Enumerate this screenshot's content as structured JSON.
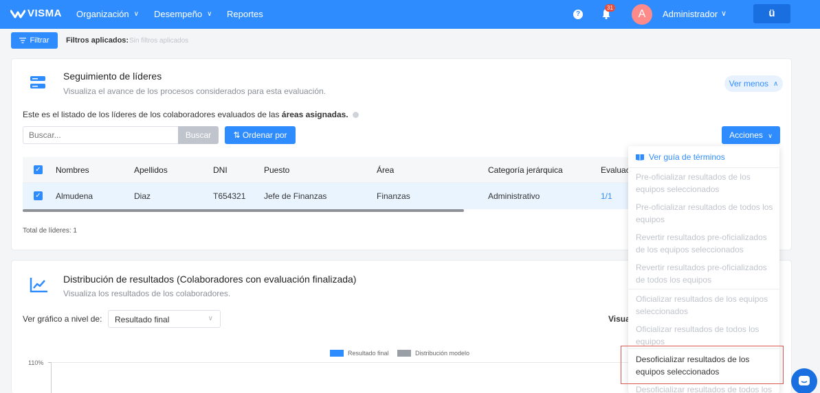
{
  "header": {
    "logo_text": "VISMA",
    "nav": [
      {
        "label": "Organización",
        "has_chevron": true
      },
      {
        "label": "Desempeño",
        "has_chevron": true
      },
      {
        "label": "Reportes",
        "has_chevron": false
      }
    ],
    "help_icon": "question-icon",
    "notifications_count": "31",
    "avatar_initial": "A",
    "user_name": "Administrador",
    "app_button_icon": "app-logo-icon",
    "colors": {
      "bar": "#2f8cff",
      "avatar": "#ff8a8a",
      "badge": "#e74c3c"
    }
  },
  "filters": {
    "button_label": "Filtrar",
    "applied_label": "Filtros aplicados:",
    "applied_value": "Sin filtros aplicados"
  },
  "leaders": {
    "title": "Seguimiento de líderes",
    "subtitle": "Visualiza el avance de los procesos considerados para esta evaluación.",
    "toggle_label": "Ver menos",
    "info_prefix": "Este es el listado de los líderes de los colaboradores evaluados de las",
    "info_bold": "áreas asignadas.",
    "search_placeholder": "Buscar...",
    "search_button": "Buscar",
    "sort_button": "Ordenar por",
    "actions_button": "Acciones",
    "columns": [
      "Nombres",
      "Apellidos",
      "DNI",
      "Puesto",
      "Área",
      "Categoría jerárquica",
      "Evaluaci"
    ],
    "rows": [
      {
        "nombres": "Almudena",
        "apellidos": "Diaz",
        "dni": "T654321",
        "puesto": "Jefe de Finanzas",
        "area": "Finanzas",
        "categoria": "Administrativo",
        "evaluacion": "1/1",
        "selected": true
      }
    ],
    "total_label": "Total de líderes: 1"
  },
  "distribution": {
    "title": "Distribución de resultados",
    "title_suffix": "(Colaboradores con evaluación finalizada)",
    "subtitle": "Visualiza los resultados de los colaboradores.",
    "level_label": "Ver gráfico a nivel de:",
    "level_value": "Resultado final",
    "right_label": "Visua",
    "legend": [
      {
        "name": "Resultado final",
        "color": "#2f8cff"
      },
      {
        "name": "Distribución modelo",
        "color": "#9a9ea5"
      }
    ],
    "y_tick_top": "110%"
  },
  "actions_menu": {
    "guide": "Ver guía de términos",
    "items": [
      {
        "label": "Pre-oficializar resultados de los equipos seleccionados",
        "enabled": false
      },
      {
        "label": "Pre-oficializar resultados de todos los equipos",
        "enabled": false
      },
      {
        "label": "Revertir resultados pre-oficializados de los equipos seleccionados",
        "enabled": false
      },
      {
        "label": "Revertir resultados pre-oficializados de todos los equipos",
        "enabled": false
      },
      {
        "label": "Oficializar resultados de los equipos seleccionados",
        "enabled": false
      },
      {
        "label": "Oficializar resultados de todos los equipos",
        "enabled": false
      },
      {
        "label": "Desoficializar resultados de los equipos seleccionados",
        "enabled": true,
        "highlighted": true
      },
      {
        "label": "Desoficializar resultados de todos los",
        "enabled": false
      }
    ]
  }
}
